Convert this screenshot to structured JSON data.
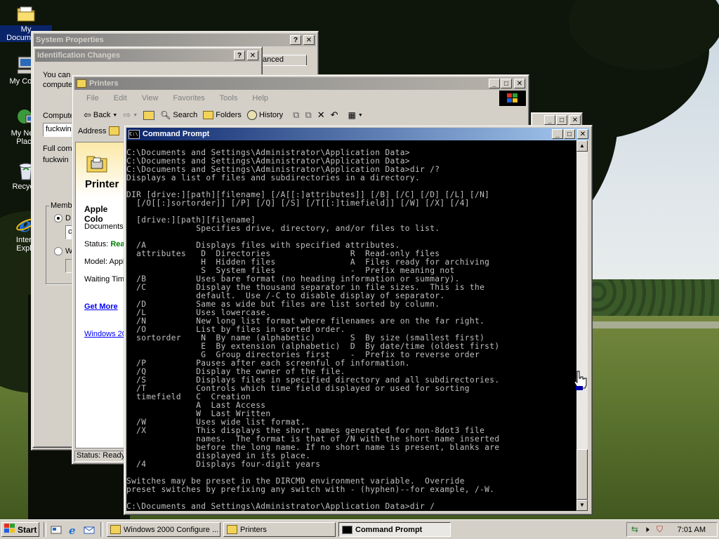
{
  "desktop": {
    "icons": [
      {
        "label": "My Documents",
        "icon": "folder-icon"
      },
      {
        "label": "My Comp",
        "icon": "computer-icon"
      },
      {
        "label": "My Netw Place",
        "icon": "network-icon"
      },
      {
        "label": "Recycle",
        "icon": "recycle-bin-icon"
      },
      {
        "label": "Intern Explo",
        "icon": "ie-icon"
      }
    ]
  },
  "system_properties": {
    "title": "System Properties",
    "tab_partial": "anced",
    "partial_text_1": "You can",
    "partial_text_2": "compute",
    "computer_label": "Compute",
    "computer_value": "fuckwin",
    "full_label": "Full com",
    "full_value": "fuckwin",
    "member_label": "Memb",
    "radio1_partial": "D",
    "radio2_partial": "W",
    "combo_partial": "c"
  },
  "identification_changes": {
    "title": "Identification Changes"
  },
  "printers": {
    "title": "Printers",
    "menu": [
      "File",
      "Edit",
      "View",
      "Favorites",
      "Tools",
      "Help"
    ],
    "toolbar": {
      "back": "Back",
      "search": "Search",
      "folders": "Folders",
      "history": "History"
    },
    "address_label": "Address",
    "heading": "Printer",
    "selected": "Apple Colo",
    "documents_label": "Documents:",
    "status_label": "Status:",
    "status_value": "Rea",
    "model_label": "Model:",
    "model_value": "Appl",
    "waiting_label": "Waiting Time",
    "get_more": "Get More",
    "windows_link": "Windows 20",
    "statusbar": "Status: Ready"
  },
  "cmd": {
    "title": "Command Prompt",
    "lines": [
      "",
      "C:\\Documents and Settings\\Administrator\\Application Data>",
      "C:\\Documents and Settings\\Administrator\\Application Data>",
      "C:\\Documents and Settings\\Administrator\\Application Data>dir /?",
      "Displays a list of files and subdirectories in a directory.",
      "",
      "DIR [drive:][path][filename] [/A[[:]attributes]] [/B] [/C] [/D] [/L] [/N]",
      "  [/O[[:]sortorder]] [/P] [/Q] [/S] [/T[[:]timefield]] [/W] [/X] [/4]",
      "",
      "  [drive:][path][filename]",
      "              Specifies drive, directory, and/or files to list.",
      "",
      "  /A          Displays files with specified attributes.",
      "  attributes   D  Directories                R  Read-only files",
      "               H  Hidden files               A  Files ready for archiving",
      "               S  System files               -  Prefix meaning not",
      "  /B          Uses bare format (no heading information or summary).",
      "  /C          Display the thousand separator in file sizes.  This is the",
      "              default.  Use /-C to disable display of separator.",
      "  /D          Same as wide but files are list sorted by column.",
      "  /L          Uses lowercase.",
      "  /N          New long list format where filenames are on the far right.",
      "  /O          List by files in sorted order.",
      "  sortorder    N  By name (alphabetic)       S  By size (smallest first)",
      "               E  By extension (alphabetic)  D  By date/time (oldest first)",
      "               G  Group directories first    -  Prefix to reverse order",
      "  /P          Pauses after each screenful of information.",
      "  /Q          Display the owner of the file.",
      "  /S          Displays files in specified directory and all subdirectories.",
      "  /T          Controls which time field displayed or used for sorting",
      "  timefield   C  Creation",
      "              A  Last Access",
      "              W  Last Written",
      "  /W          Uses wide list format.",
      "  /X          This displays the short names generated for non-8dot3 file",
      "              names.  The format is that of /N with the short name inserted",
      "              before the long name. If no short name is present, blanks are",
      "              displayed in its place.",
      "  /4          Displays four-digit years",
      "",
      "Switches may be preset in the DIRCMD environment variable.  Override",
      "preset switches by prefixing any switch with - (hyphen)--for example, /-W.",
      "",
      "C:\\Documents and Settings\\Administrator\\Application Data>dir /"
    ]
  },
  "taskbar": {
    "start": "Start",
    "tasks": [
      {
        "label": "Windows 2000 Configure ...",
        "icon": "folder-icon",
        "active": false
      },
      {
        "label": "Printers",
        "icon": "printer-folder-icon",
        "active": false
      },
      {
        "label": "Command Prompt",
        "icon": "cmd-icon",
        "active": true
      }
    ],
    "clock": "7:01 AM"
  },
  "colors": {
    "active_title": "#0a246a",
    "inactive_title": "#808080",
    "window_face": "#d4d0c8",
    "console_text": "#c0c0c0"
  }
}
